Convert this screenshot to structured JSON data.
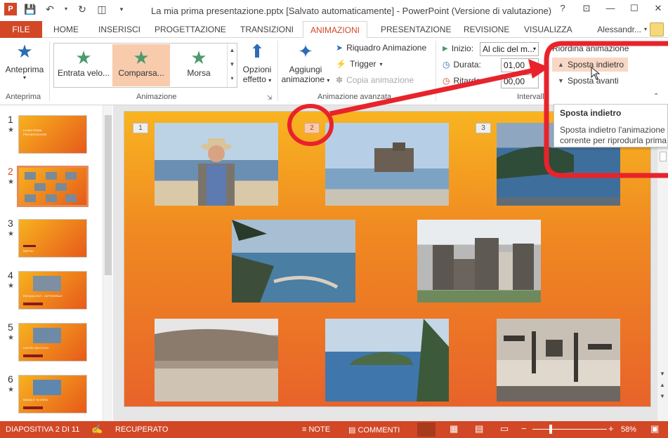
{
  "window": {
    "title": "La mia prima presentazione.pptx [Salvato automaticamente] - PowerPoint (Versione di valutazione)",
    "controls": [
      "?",
      "⊡",
      "—",
      "☐",
      "✕"
    ]
  },
  "tabs": {
    "file": "FILE",
    "items": [
      "HOME",
      "INSERISCI",
      "PROGETTAZIONE",
      "TRANSIZIONI",
      "ANIMAZIONI",
      "PRESENTAZIONE",
      "REVISIONE",
      "VISUALIZZA"
    ],
    "active": "ANIMAZIONI",
    "user": "Alessandr..."
  },
  "ribbon": {
    "preview": {
      "label": "Anteprima",
      "group": "Anteprima"
    },
    "animation_gallery": {
      "items": [
        "Entrata velo...",
        "Comparsa...",
        "Morsa"
      ],
      "selected": "Comparsa...",
      "group": "Animazione"
    },
    "effect_options": {
      "label1": "Opzioni",
      "label2": "effetto"
    },
    "add_animation": {
      "label1": "Aggiungi",
      "label2": "animazione"
    },
    "advanced": {
      "pane": "Riquadro Animazione",
      "trigger": "Trigger",
      "copy": "Copia animazione",
      "group": "Animazione avanzata"
    },
    "timing": {
      "start_label": "Inizio:",
      "start_value": "Al clic del m...",
      "duration_label": "Durata:",
      "duration_value": "01,00",
      "delay_label": "Ritardo:",
      "delay_value": "00,00",
      "group": "Intervallo"
    },
    "reorder": {
      "title": "Riordina animazione",
      "back": "Sposta indietro",
      "forward": "Sposta avanti"
    }
  },
  "tooltip": {
    "title": "Sposta indietro",
    "line1": "Sposta indietro l'animazione",
    "line2": "corrente per riprodurla prima"
  },
  "slides": [
    {
      "num": "1",
      "text1": "LA MIA PRIMA",
      "text2": "PRESENTAZIONE"
    },
    {
      "num": "2"
    },
    {
      "num": "3",
      "text1": "NAPOLI"
    },
    {
      "num": "4",
      "text1": "PASQUA 2017 - CATTEDRALE"
    },
    {
      "num": "5",
      "text1": "CASTEL DELL'OVO"
    },
    {
      "num": "6",
      "text1": "NISIDA E' IN VISTA"
    }
  ],
  "slide_badges": [
    "1",
    "2",
    "3"
  ],
  "status": {
    "slide": "DIAPOSITIVA 2 DI 11",
    "recovered": "RECUPERATO",
    "notes": "NOTE",
    "comments": "COMMENTI",
    "zoom": "58%"
  },
  "colors": {
    "accent": "#d24726",
    "highlight": "#f8cbad",
    "annotation": "#e8232b"
  }
}
